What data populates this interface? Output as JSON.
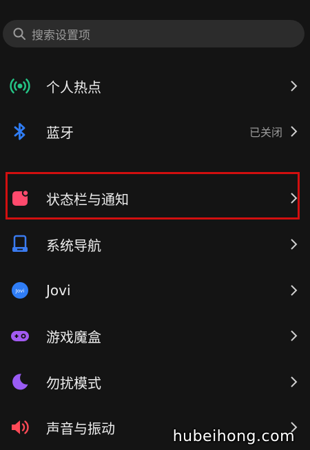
{
  "search": {
    "placeholder": "搜索设置项",
    "icon": "search-icon"
  },
  "settings": {
    "items": [
      {
        "label": "个人热点",
        "icon": "hotspot-icon",
        "color": "#25c486",
        "value": ""
      },
      {
        "label": "蓝牙",
        "icon": "bluetooth-icon",
        "color": "#2f7df6",
        "value": "已关闭"
      },
      {
        "label": "状态栏与通知",
        "icon": "notification-icon",
        "color": "#ff4a6d",
        "value": ""
      },
      {
        "label": "系统导航",
        "icon": "navigation-icon",
        "color": "#3a7bf0",
        "value": ""
      },
      {
        "label": "Jovi",
        "icon": "jovi-icon",
        "color": "#2f7df6",
        "value": ""
      },
      {
        "label": "游戏魔盒",
        "icon": "game-box-icon",
        "color": "#a25af2",
        "value": ""
      },
      {
        "label": "勿扰模式",
        "icon": "do-not-disturb-icon",
        "color": "#9a5cf5",
        "value": ""
      },
      {
        "label": "声音与振动",
        "icon": "sound-icon",
        "color": "#ff4a57",
        "value": ""
      }
    ]
  },
  "highlight_color": "#d20f0f",
  "watermark": "hubeihong.com"
}
